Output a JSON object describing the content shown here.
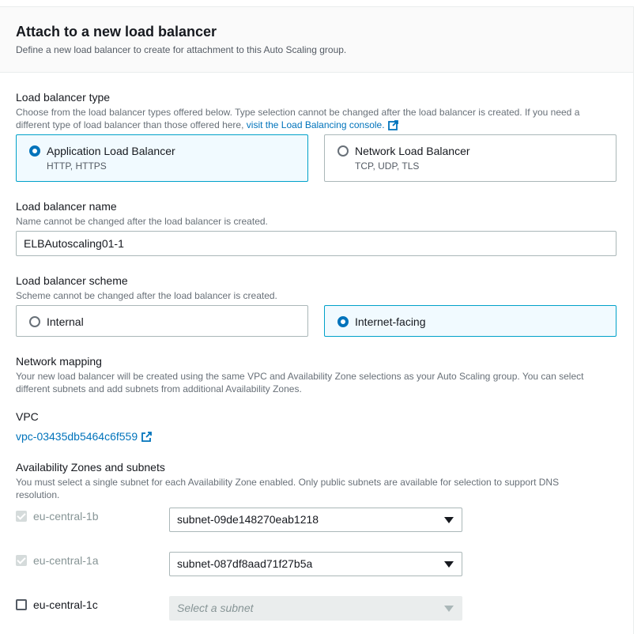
{
  "header": {
    "title": "Attach to a new load balancer",
    "description": "Define a new load balancer to create for attachment to this Auto Scaling group."
  },
  "lb_type": {
    "label": "Load balancer type",
    "hint_line1": "Choose from the load balancer types offered below. Type selection cannot be changed after the load balancer is created. If you need a",
    "hint_line2": "different type of load balancer than those offered here,",
    "hint_link": "visit the Load Balancing console.",
    "options": [
      {
        "title": "Application Load Balancer",
        "subtitle": "HTTP, HTTPS",
        "selected": true
      },
      {
        "title": "Network Load Balancer",
        "subtitle": "TCP, UDP, TLS",
        "selected": false
      }
    ]
  },
  "lb_name": {
    "label": "Load balancer name",
    "hint": "Name cannot be changed after the load balancer is created.",
    "value": "ELBAutoscaling01-1"
  },
  "lb_scheme": {
    "label": "Load balancer scheme",
    "hint": "Scheme cannot be changed after the load balancer is created.",
    "options": [
      {
        "title": "Internal",
        "selected": false
      },
      {
        "title": "Internet-facing",
        "selected": true
      }
    ]
  },
  "network_mapping": {
    "label": "Network mapping",
    "hint_line1": "Your new load balancer will be created using the same VPC and Availability Zone selections as your Auto Scaling group. You can select",
    "hint_line2": "different subnets and add subnets from additional Availability Zones."
  },
  "vpc": {
    "label": "VPC",
    "value": "vpc-03435db5464c6f559"
  },
  "az_subnets": {
    "label": "Availability Zones and subnets",
    "hint_line1": "You must select a single subnet for each Availability Zone enabled. Only public subnets are available for selection to support DNS",
    "hint_line2": "resolution.",
    "zones": [
      {
        "zone": "eu-central-1b",
        "checked": true,
        "disabled": true,
        "subnet": "subnet-09de148270eab1218"
      },
      {
        "zone": "eu-central-1a",
        "checked": true,
        "disabled": true,
        "subnet": "subnet-087df8aad71f27b5a"
      },
      {
        "zone": "eu-central-1c",
        "checked": false,
        "disabled": false,
        "subnet_placeholder": "Select a subnet"
      }
    ]
  },
  "colors": {
    "accent": "#0073bb",
    "selected_border": "#00a1c9",
    "selected_bg": "#f1faff",
    "text": "#16191f",
    "muted": "#687078"
  },
  "icons": {
    "external_link": "external-link-icon",
    "caret": "caret-down-icon"
  }
}
